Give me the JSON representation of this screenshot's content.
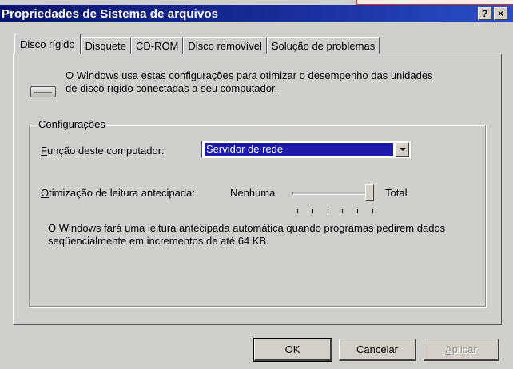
{
  "window": {
    "title": "Propriedades de Sistema de arquivos",
    "help_glyph": "?",
    "close_glyph": "×"
  },
  "tabs": [
    {
      "label": "Disco rígido",
      "active": true
    },
    {
      "label": "Disquete",
      "active": false
    },
    {
      "label": "CD-ROM",
      "active": false
    },
    {
      "label": "Disco removível",
      "active": false
    },
    {
      "label": "Solução de problemas",
      "active": false
    }
  ],
  "intro": {
    "icon": "hard-drive-icon",
    "text": "O Windows usa estas configurações para otimizar o desempenho das unidades de disco rígido conectadas a seu computador."
  },
  "settings": {
    "group_label": "Configurações",
    "function_label_accel": "F",
    "function_label_rest": "unção deste computador:",
    "function_value": "Servidor de rede",
    "readahead_label_accel": "O",
    "readahead_label_rest": "timização de leitura antecipada:",
    "slider_min_label": "Nenhuma",
    "slider_max_label": "Total",
    "slider_value_fraction": 1.0,
    "slider_tick_count": 6,
    "description": "O Windows fará uma leitura antecipada automática quando programas pedirem dados seqüencialmente em incrementos de até 64 KB."
  },
  "buttons": {
    "ok": "OK",
    "cancel": "Cancelar",
    "apply_accel": "A",
    "apply_rest": "plicar"
  },
  "colors": {
    "title_gradient_start": "#07136e",
    "title_gradient_end": "#2b4fc6",
    "selection": "#1c1aa6",
    "face": "#cfcfcc"
  }
}
